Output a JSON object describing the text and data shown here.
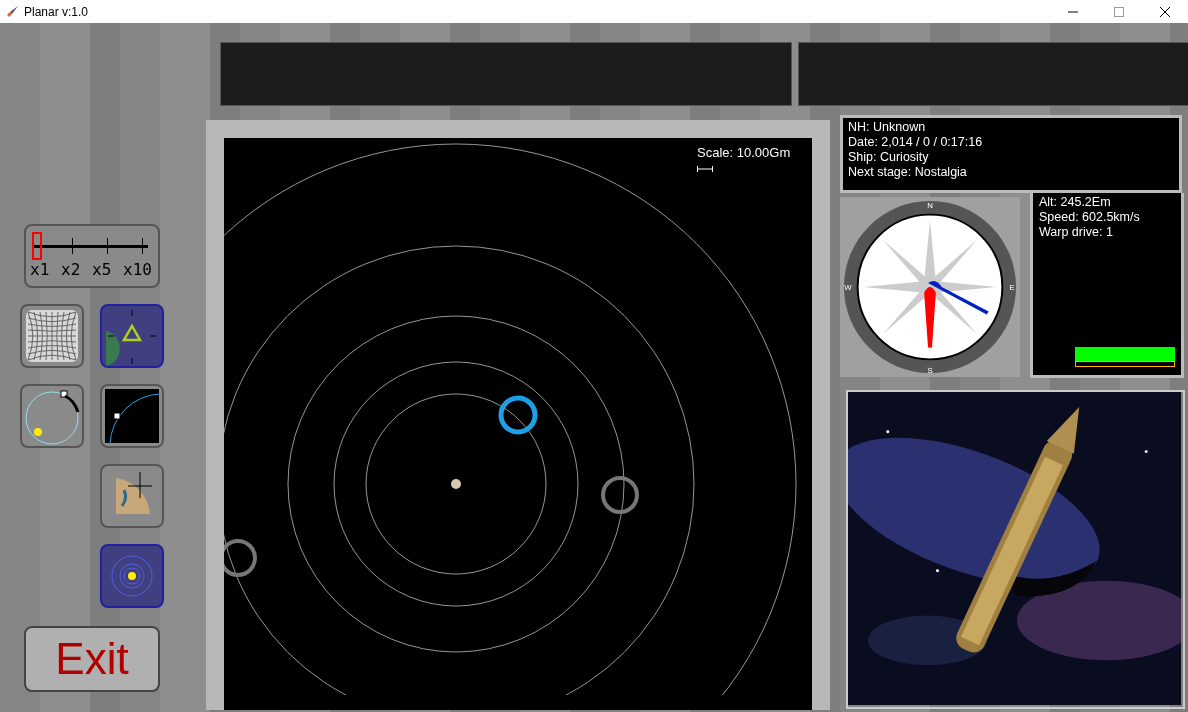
{
  "window": {
    "title": "Planar v:1.0"
  },
  "warp_selector": {
    "stops": [
      {
        "label": "x1",
        "selected": true
      },
      {
        "label": "x2",
        "selected": false
      },
      {
        "label": "x5",
        "selected": false
      },
      {
        "label": "x10",
        "selected": false
      }
    ]
  },
  "tools": [
    {
      "kind": "grid",
      "selected": false
    },
    {
      "kind": "navigate",
      "selected": true
    },
    {
      "kind": "orbit",
      "selected": false
    },
    {
      "kind": "zoom-orbit",
      "selected": false
    },
    {
      "kind": "move",
      "selected": false
    },
    {
      "kind": "system",
      "selected": true
    }
  ],
  "exit_button": {
    "label": "Exit"
  },
  "map": {
    "scale": "Scale: 10.00Gm"
  },
  "info": {
    "lines": [
      "NH: Unknown",
      "Date: 2,014 / 0 / 0:17:16",
      "Ship: Curiosity",
      "Next stage: Nostalgia"
    ]
  },
  "stats": {
    "lines": [
      "Alt: 245.2Em",
      "Speed: 602.5km/s",
      "Warp drive: 1"
    ],
    "bars": [
      {
        "level": 1,
        "color": "#00ff00"
      },
      {
        "color": "#ffb000"
      }
    ]
  },
  "compass": {
    "north": "N",
    "east": "E",
    "south": "S",
    "west": "W"
  }
}
